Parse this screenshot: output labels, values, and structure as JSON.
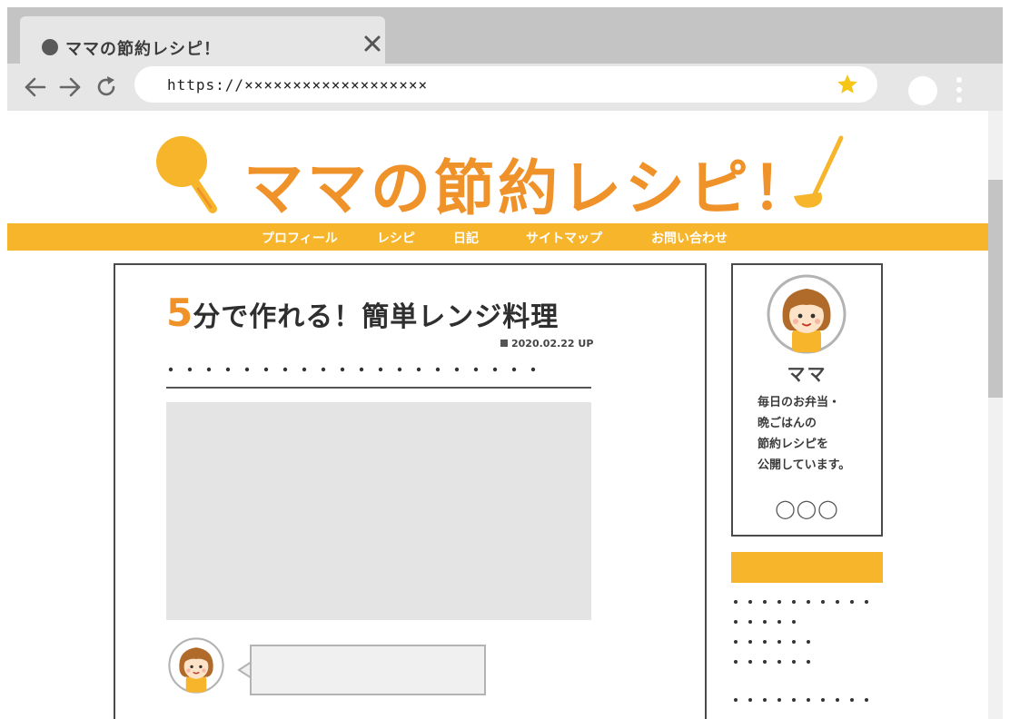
{
  "browser": {
    "tab_title": "ママの節約レシピ！",
    "url": "https://×××××××××××××××××××"
  },
  "site": {
    "title": "ママの節約レシピ！",
    "nav": [
      "プロフィール",
      "レシピ",
      "日記",
      "サイトマップ",
      "お問い合わせ"
    ]
  },
  "article": {
    "title_number": "5",
    "title_rest": "分で作れる！簡単レンジ料理",
    "date": "2020.02.22 UP"
  },
  "profile": {
    "name": "ママ",
    "bio": [
      "毎日のお弁当・",
      "晩ごはんの",
      "節約レシピを",
      "公開しています。"
    ],
    "circles": "◯◯◯"
  },
  "colors": {
    "accent_yellow": "#f7b52b",
    "accent_orange": "#f0922a",
    "chrome_gray": "#c4c4c4",
    "placeholder_gray": "#e4e4e4"
  },
  "icons": [
    "tab-favicon-icon",
    "close-icon",
    "back-arrow-icon",
    "forward-arrow-icon",
    "reload-icon",
    "bookmark-star-icon",
    "kebab-menu-icon",
    "frying-pan-icon",
    "ladle-icon",
    "avatar-icon"
  ]
}
